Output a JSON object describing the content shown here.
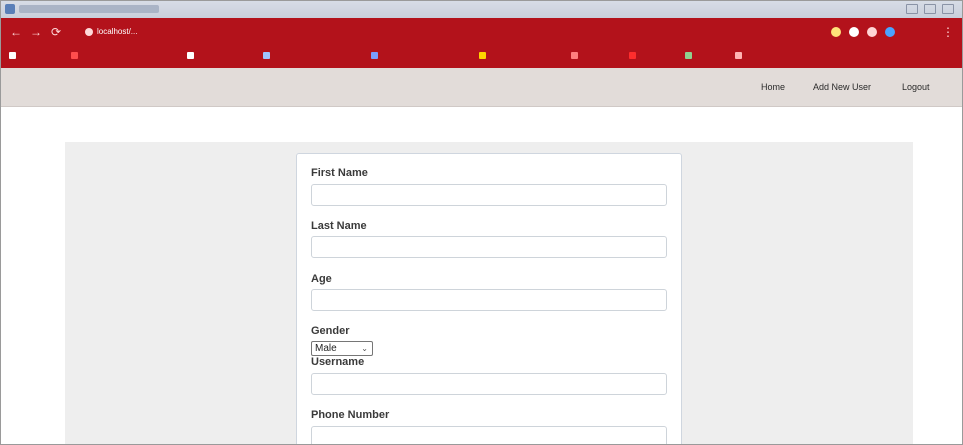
{
  "browser": {
    "accent_color": "#b3121b",
    "url_text": "localhost/...",
    "nav_icons": [
      "back-icon",
      "forward-icon",
      "reload-icon"
    ]
  },
  "app_nav": {
    "links": [
      "Home",
      "Add New User",
      "Logout"
    ]
  },
  "form": {
    "first_name": {
      "label": "First Name",
      "value": ""
    },
    "last_name": {
      "label": "Last Name",
      "value": ""
    },
    "age": {
      "label": "Age",
      "value": ""
    },
    "gender": {
      "label": "Gender",
      "selected": "Male"
    },
    "username": {
      "label": "Username",
      "value": ""
    },
    "phone_number": {
      "label": "Phone Number",
      "value": ""
    }
  }
}
